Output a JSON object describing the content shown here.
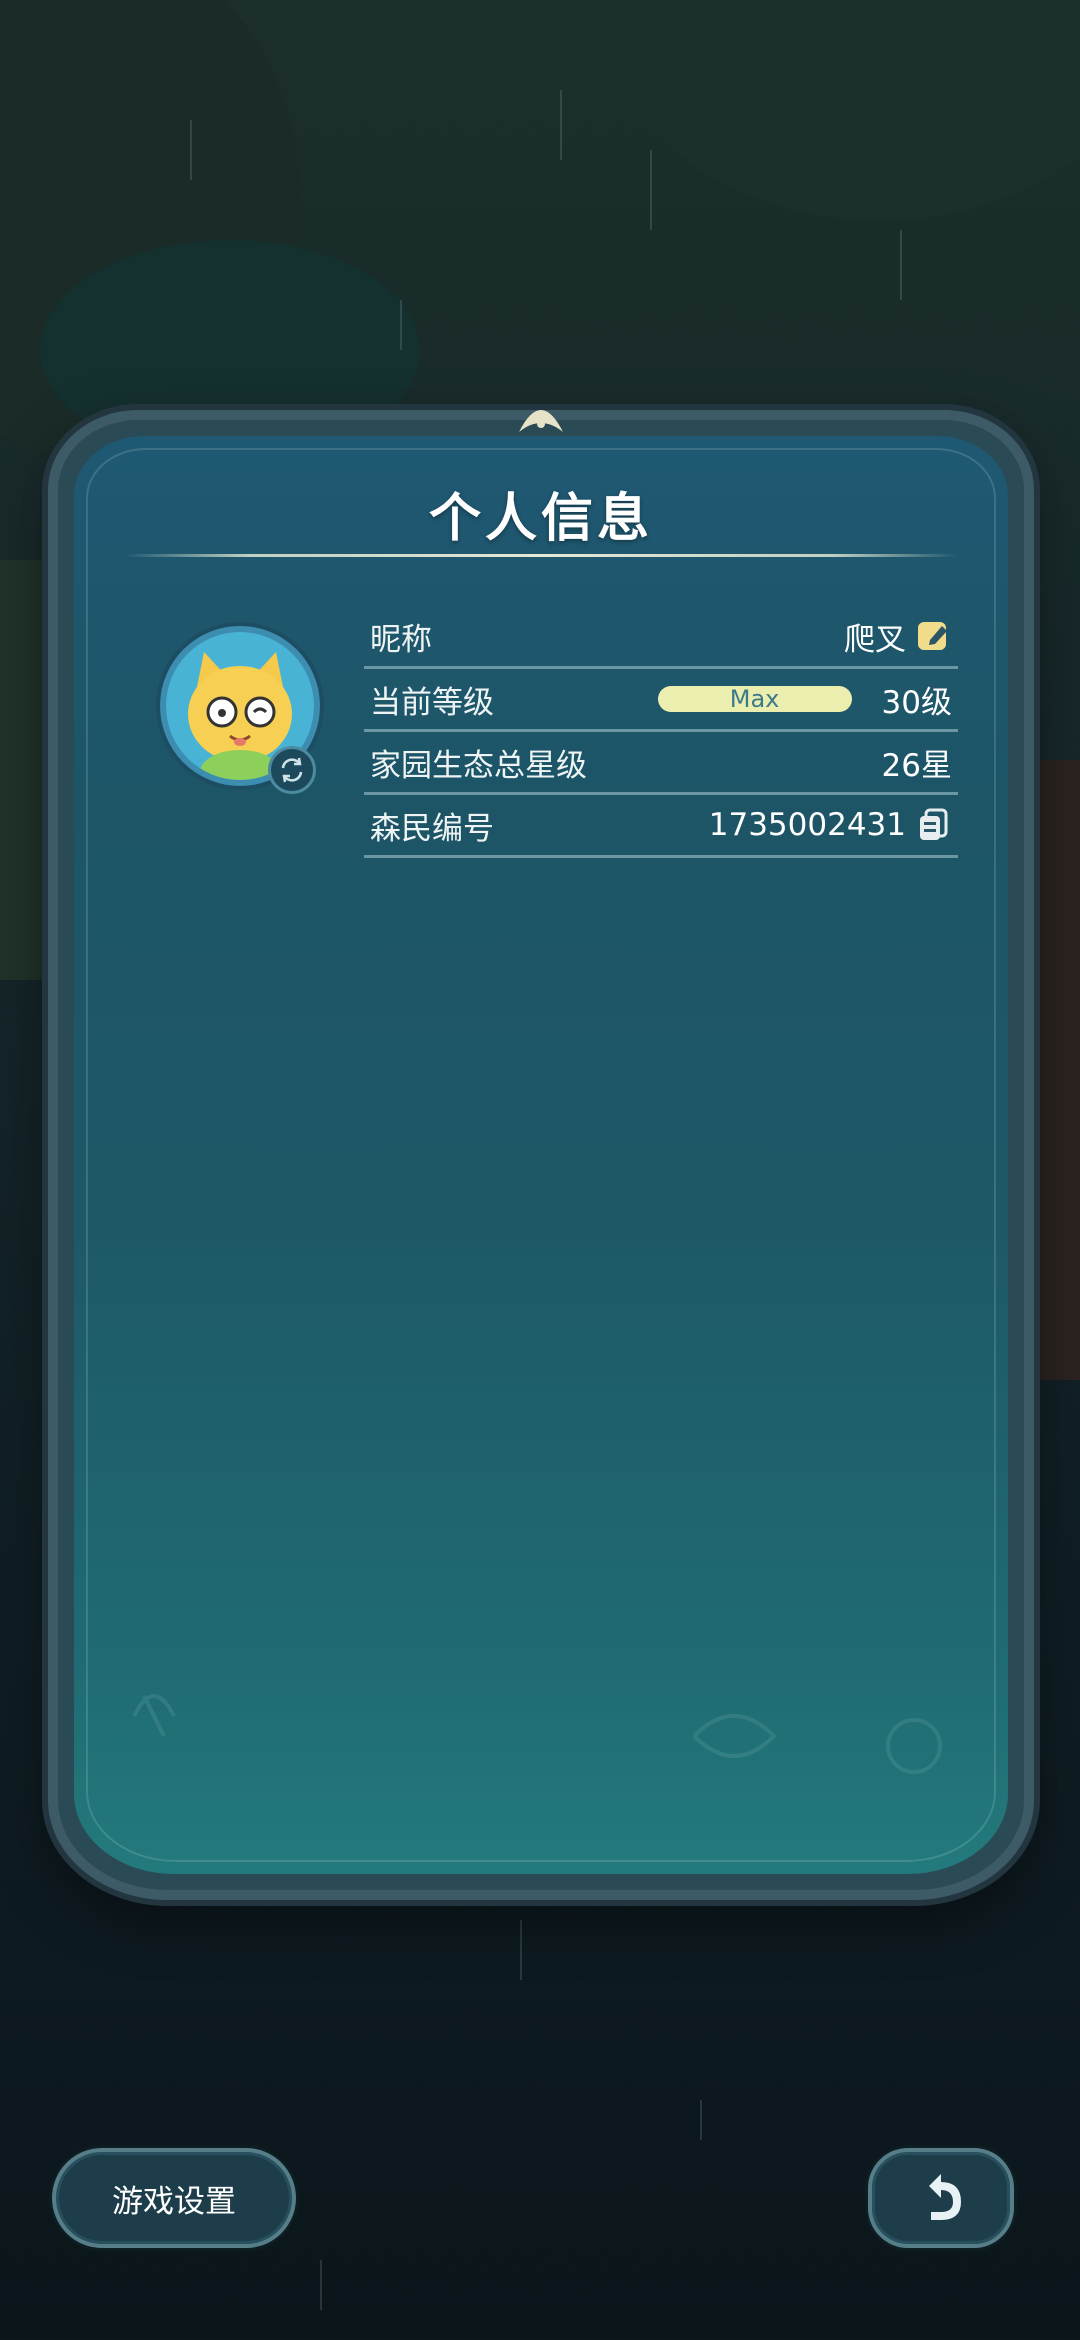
{
  "panel": {
    "title": "个人信息"
  },
  "profile": {
    "rows": [
      {
        "label": "昵称",
        "value": "爬叉"
      },
      {
        "label": "当前等级",
        "bar_text": "Max",
        "value": "30级"
      },
      {
        "label": "家园生态总星级",
        "value": "26星"
      },
      {
        "label": "森民编号",
        "value": "1735002431"
      }
    ]
  },
  "buttons": {
    "settings_label": "游戏设置"
  },
  "icons": {
    "edit": "edit-icon",
    "copy": "copy-icon",
    "swap_avatar": "swap-icon",
    "back": "back-arrow-icon"
  },
  "colors": {
    "panel_top": "#1f5872",
    "panel_bottom": "#237a7c",
    "accent_bar": "#eceeb0",
    "edit_icon": "#f0dc8a"
  }
}
